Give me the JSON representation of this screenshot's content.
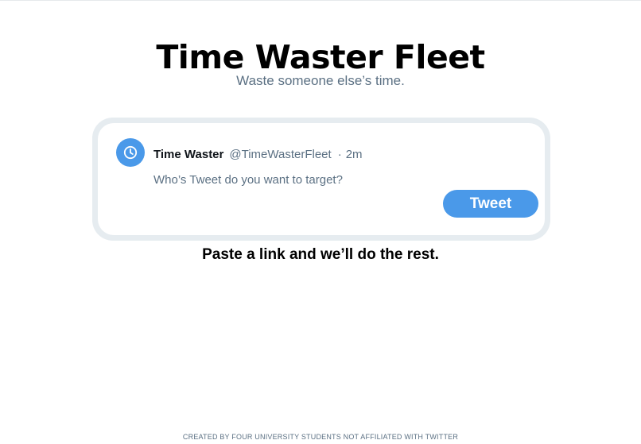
{
  "page": {
    "title": "Time Waster Fleet",
    "subtitle": "Waste someone else’s time.",
    "tagline": "Paste a link and we’ll do the rest.",
    "footer": "CREATED BY FOUR UNIVERSITY STUDENTS NOT AFFILIATED WITH TWITTER"
  },
  "composer": {
    "avatar_icon": "clock-icon",
    "display_name": "Time Waster",
    "handle": "@TimeWasterFleet",
    "separator": "·",
    "time": "2m",
    "input_value": "",
    "input_placeholder": "Who’s Tweet do you want to target?",
    "button_label": "Tweet"
  },
  "colors": {
    "accent": "#4a99e9",
    "muted_text": "#5b7083",
    "card_border": "#e6ecf0"
  }
}
